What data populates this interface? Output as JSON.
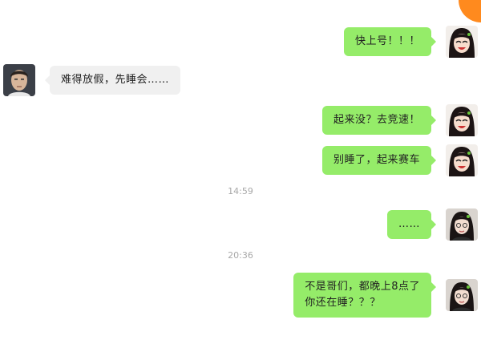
{
  "messages": [
    {
      "sender": "me",
      "text": "快上号！！！"
    },
    {
      "sender": "friend",
      "text": "难得放假，先睡会……"
    },
    {
      "sender": "me",
      "text": "起来没？去竞速！"
    },
    {
      "sender": "me",
      "text": "别睡了，起来赛车"
    },
    {
      "sender": "me",
      "text": "……"
    },
    {
      "sender": "me",
      "text": "不是哥们，都晚上8点了\n你还在睡？？？"
    }
  ],
  "timestamps": [
    "14:59",
    "20:36"
  ],
  "colors": {
    "my_bubble": "#95ec69",
    "friend_bubble": "#f0f0f0",
    "corner_accent": "#ff8a1e"
  },
  "icons": {
    "my_avatar": "woman-avatar-icon",
    "friend_avatar": "man-avatar-icon"
  }
}
